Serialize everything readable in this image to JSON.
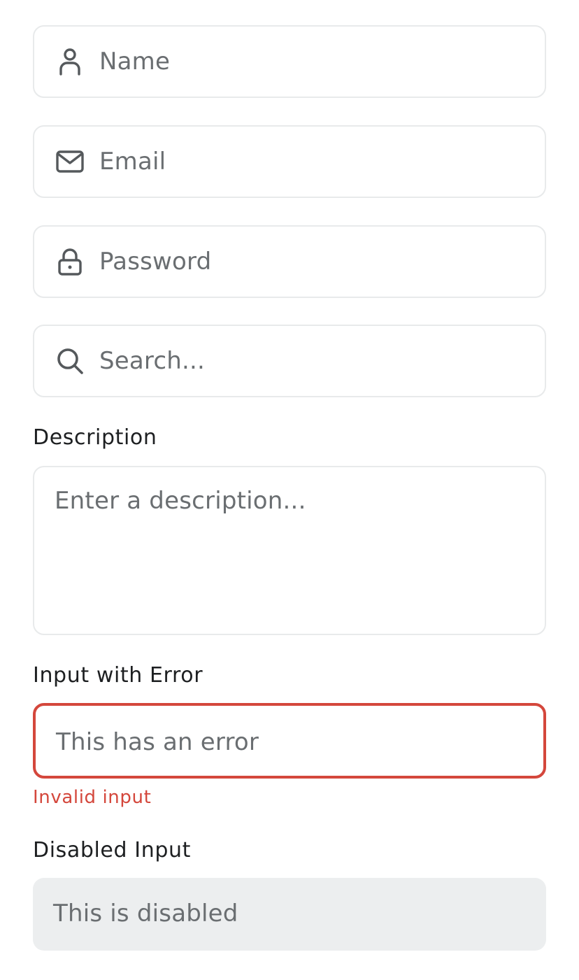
{
  "inputs": {
    "name": {
      "placeholder": "Name",
      "icon": "user-icon"
    },
    "email": {
      "placeholder": "Email",
      "icon": "mail-icon"
    },
    "password": {
      "placeholder": "Password",
      "icon": "lock-icon"
    },
    "search": {
      "placeholder": "Search...",
      "icon": "search-icon"
    }
  },
  "description": {
    "label": "Description",
    "placeholder": "Enter a description..."
  },
  "error_input": {
    "label": "Input with Error",
    "value": "This has an error",
    "error_message": "Invalid input",
    "error_color": "#d4473c"
  },
  "disabled_input": {
    "label": "Disabled Input",
    "value": "This is disabled"
  },
  "colors": {
    "border": "#e8eaeb",
    "placeholder": "#6a6e71",
    "label": "#1d1f21",
    "disabled_bg": "#eceeef"
  }
}
